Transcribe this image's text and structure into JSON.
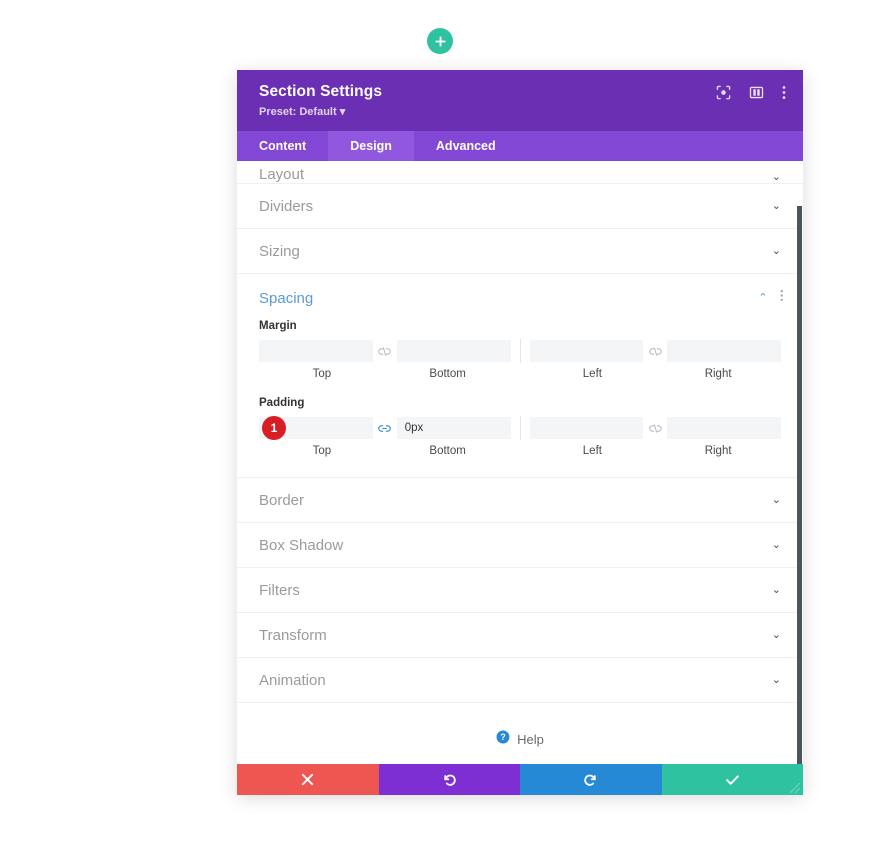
{
  "canvas": {
    "add_section_button": {
      "name": "add-section",
      "icon": "plus-icon",
      "color": "#2ec2a0"
    }
  },
  "modal": {
    "title": "Section Settings",
    "preset": "Preset: Default",
    "preset_caret": "▾",
    "header_icons": [
      {
        "name": "focus-icon",
        "label": "Focus"
      },
      {
        "name": "layout-columns-icon",
        "label": "Layout"
      },
      {
        "name": "more-vertical-icon",
        "label": "More"
      }
    ],
    "tabs": [
      {
        "label": "Content",
        "active": false
      },
      {
        "label": "Design",
        "active": true
      },
      {
        "label": "Advanced",
        "active": false
      }
    ],
    "sections_above": [
      {
        "label": "Layout",
        "chevron": "⌄",
        "cut_off": true
      },
      {
        "label": "Dividers",
        "chevron": "⌄"
      },
      {
        "label": "Sizing",
        "chevron": "⌄"
      }
    ],
    "spacing": {
      "title": "Spacing",
      "chevron": "⌃",
      "more_icon": "more-vertical-icon",
      "margin": {
        "label": "Margin",
        "link_icon": "unlinked-icon",
        "link_state": "unlinked",
        "fields": [
          {
            "caption": "Top",
            "value": "",
            "placeholder": ""
          },
          {
            "caption": "Bottom",
            "value": "",
            "placeholder": ""
          },
          {
            "caption": "Left",
            "value": "",
            "placeholder": ""
          },
          {
            "caption": "Right",
            "value": "",
            "placeholder": ""
          }
        ]
      },
      "padding": {
        "label": "Padding",
        "badge": "1",
        "badge_color": "#d61e24",
        "link_icon_left": "linked-icon",
        "link_state_left": "linked",
        "link_icon_right": "unlinked-icon",
        "link_state_right": "unlinked",
        "fields": [
          {
            "caption": "Top",
            "value": "0px",
            "placeholder": ""
          },
          {
            "caption": "Bottom",
            "value": "0px",
            "placeholder": ""
          },
          {
            "caption": "Left",
            "value": "",
            "placeholder": ""
          },
          {
            "caption": "Right",
            "value": "",
            "placeholder": ""
          }
        ]
      }
    },
    "sections_below": [
      {
        "label": "Border",
        "chevron": "⌄"
      },
      {
        "label": "Box Shadow",
        "chevron": "⌄"
      },
      {
        "label": "Filters",
        "chevron": "⌄"
      },
      {
        "label": "Transform",
        "chevron": "⌄"
      },
      {
        "label": "Animation",
        "chevron": "⌄"
      }
    ],
    "help": {
      "label": "Help",
      "icon": "question-circle-icon"
    },
    "footer": [
      {
        "name": "cancel-button",
        "icon": "close-icon",
        "color": "#EE5651"
      },
      {
        "name": "undo-button",
        "icon": "undo-icon",
        "color": "#7D2FD4"
      },
      {
        "name": "redo-button",
        "icon": "redo-icon",
        "color": "#2689D6"
      },
      {
        "name": "save-button",
        "icon": "checkmark-icon",
        "color": "#2EC2A0"
      }
    ],
    "colors": {
      "header_purple": "#6B2FB3",
      "tabbar_purple": "#8247D4",
      "active_tab_purple": "#9257DF",
      "spacing_blue": "#5b9bd5"
    }
  }
}
